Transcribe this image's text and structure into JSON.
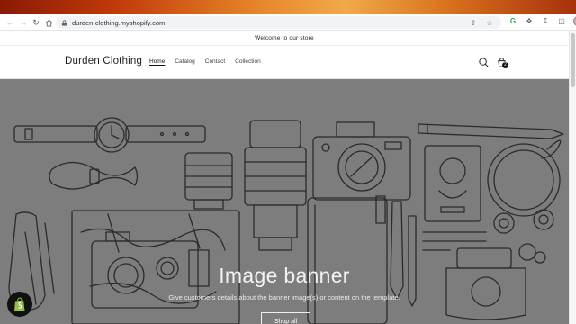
{
  "browser": {
    "url": "durden-clothing.myshopify.com"
  },
  "announcement": {
    "text": "Welcome to our store"
  },
  "store": {
    "brand": "Durden Clothing",
    "nav": [
      {
        "label": "Home",
        "active": true
      },
      {
        "label": "Catalog",
        "active": false
      },
      {
        "label": "Contact",
        "active": false
      },
      {
        "label": "Collection",
        "active": false
      }
    ],
    "cart_count": "2"
  },
  "banner": {
    "title": "Image banner",
    "subtitle": "Give customers details about the banner image(s) or content on the template.",
    "button_label": "Shop all"
  },
  "colors": {
    "banner_bg": "#7d7d7d",
    "line_art": "#2b2b2b"
  }
}
